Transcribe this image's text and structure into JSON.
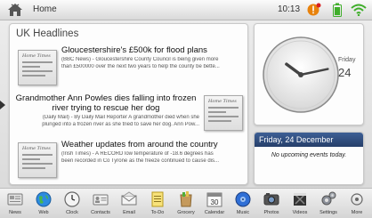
{
  "status_bar": {
    "home_label": "Home",
    "time": "10:13",
    "icons": [
      "home-icon",
      "notification-icon",
      "battery-icon",
      "wifi-icon"
    ]
  },
  "headlines": {
    "section_title": "UK Headlines",
    "items": [
      {
        "title": "Gloucestershire's £500k for flood plans",
        "body_line1": "(BBC News) - Gloucestershire County Council is being given more",
        "body_line2": "than £500000 over the next two years to help the county be bette..."
      },
      {
        "title_line1": "Grandmother Ann Powles dies falling into frozen",
        "title_line2": "river trying to rescue her dog",
        "body_line1": "(Daily Mail) - By Daily Mail Reporter A grandmother died when she",
        "body_line2": "plunged into a frozen river as she tried to save her dog. Ann Pow..."
      },
      {
        "title": "Weather updates from around the country",
        "body_line1": "(Irish Times) - A RECORD low temperature of -18.6 degrees has",
        "body_line2": "been recorded in Co Tyrone as the freeze continued to cause dis..."
      }
    ]
  },
  "clock_widget": {
    "weekday": "Friday",
    "day_number": "24",
    "hour": 10,
    "minute": 13
  },
  "calendar_widget": {
    "date_header": "Friday, 24 December",
    "empty_message": "No upcoming events today."
  },
  "dock": {
    "items": [
      {
        "label": "News",
        "icon": "news-icon"
      },
      {
        "label": "Web",
        "icon": "globe-icon"
      },
      {
        "label": "Clock",
        "icon": "clock-icon"
      },
      {
        "label": "Contacts",
        "icon": "contacts-icon"
      },
      {
        "label": "Email",
        "icon": "email-icon"
      },
      {
        "label": "To-Do",
        "icon": "todo-icon"
      },
      {
        "label": "Grocery",
        "icon": "grocery-icon"
      },
      {
        "label": "Calendar",
        "icon": "calendar-icon",
        "badge": "30"
      },
      {
        "label": "Music",
        "icon": "music-icon"
      },
      {
        "label": "Photos",
        "icon": "photos-icon"
      },
      {
        "label": "Videos",
        "icon": "videos-icon"
      },
      {
        "label": "Settings",
        "icon": "settings-icon"
      },
      {
        "label": "More",
        "icon": "more-icon"
      }
    ]
  },
  "colors": {
    "calendar_header": "#2f4d7e",
    "notification": "#e8820c",
    "battery": "#3fae2a",
    "wifi": "#3fae2a"
  }
}
